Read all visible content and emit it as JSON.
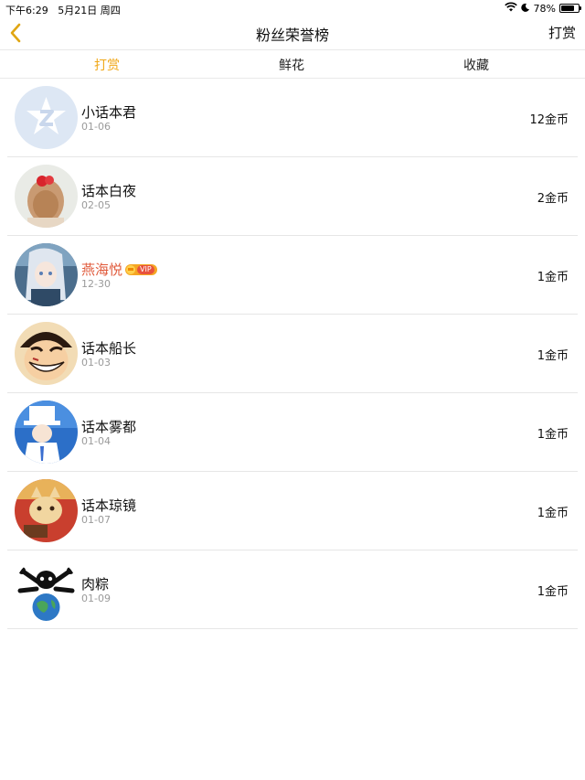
{
  "status_bar": {
    "time": "下午6:29",
    "date": "5月21日 周四",
    "battery": "78%",
    "battery_level": 0.78
  },
  "nav": {
    "title": "粉丝荣誉榜",
    "action": "打赏",
    "back_icon": "chevron-left-icon"
  },
  "tabs": [
    {
      "label": "打赏",
      "active": true
    },
    {
      "label": "鲜花",
      "active": false
    },
    {
      "label": "收藏",
      "active": false
    }
  ],
  "colors": {
    "accent": "#f0a819",
    "vip_name": "#e05a3b",
    "secondary_text": "#9a9a9a"
  },
  "fans": [
    {
      "name": "小话本君",
      "date": "01-06",
      "amount": "12金币",
      "vip": false,
      "avatar": "qq-logo-avatar"
    },
    {
      "name": "话本白夜",
      "date": "02-05",
      "amount": "2金币",
      "vip": false,
      "avatar": "girl-with-bow-avatar"
    },
    {
      "name": "燕海悦",
      "date": "12-30",
      "amount": "1金币",
      "vip": true,
      "vip_label": "VIP",
      "avatar": "anime-girl-avatar"
    },
    {
      "name": "话本船长",
      "date": "01-03",
      "amount": "1金币",
      "vip": false,
      "avatar": "luffy-avatar"
    },
    {
      "name": "话本雾都",
      "date": "01-04",
      "amount": "1金币",
      "vip": false,
      "avatar": "kid-thief-avatar"
    },
    {
      "name": "话本琼镜",
      "date": "01-07",
      "amount": "1金币",
      "vip": false,
      "avatar": "cat-avatar"
    },
    {
      "name": "肉粽",
      "date": "01-09",
      "amount": "1金币",
      "vip": false,
      "avatar": "skull-globe-avatar"
    }
  ]
}
